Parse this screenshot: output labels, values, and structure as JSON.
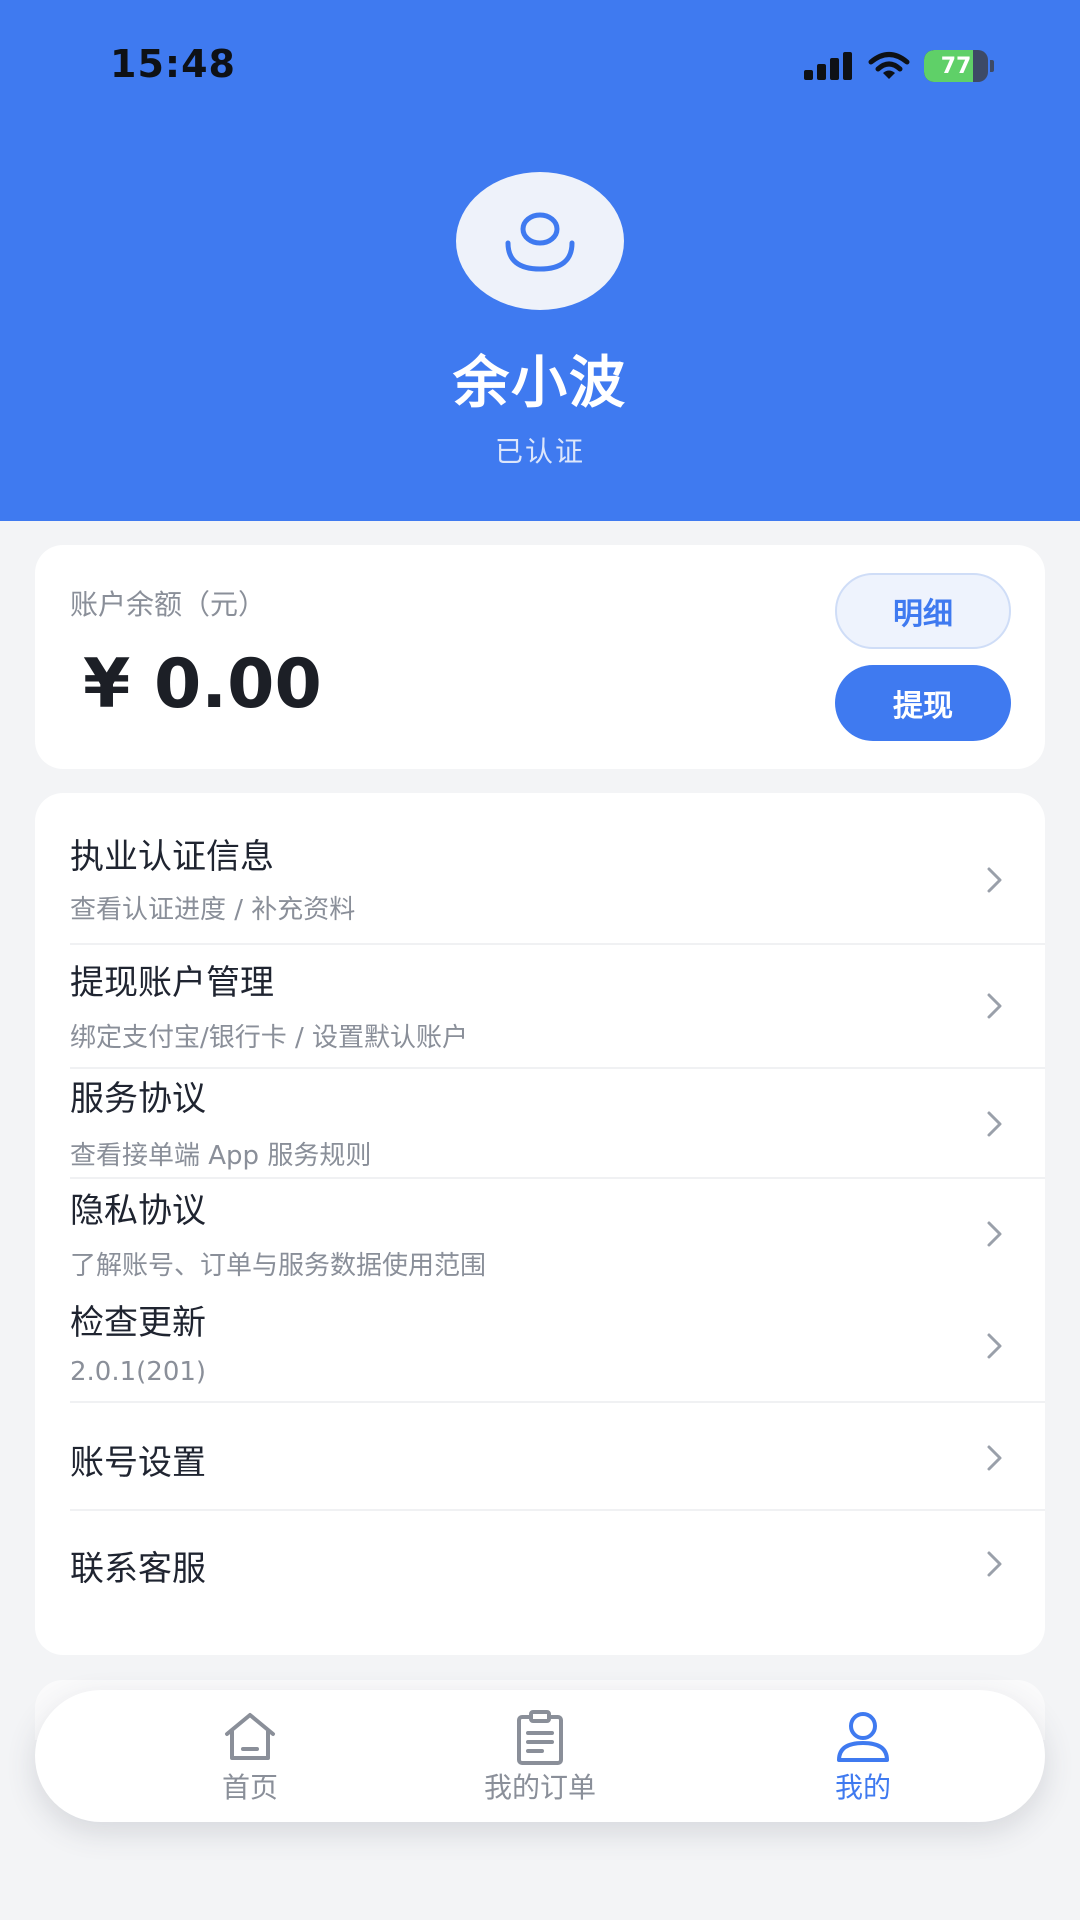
{
  "status_bar": {
    "time": "15:48",
    "battery": "77",
    "battery_level": 0.77
  },
  "profile": {
    "name": "余小波",
    "status": "已认证"
  },
  "balance": {
    "label": "账户余额（元）",
    "value": "¥ 0.00",
    "detail_label": "明细",
    "withdraw_label": "提现"
  },
  "menu": {
    "items": [
      {
        "title": "执业认证信息",
        "subtitle": "查看认证进度 / 补充资料"
      },
      {
        "title": "提现账户管理",
        "subtitle": "绑定支付宝/银行卡 / 设置默认账户"
      },
      {
        "title": "服务协议",
        "subtitle": "查看接单端 App 服务规则"
      },
      {
        "title": "隐私协议",
        "subtitle": "了解账号、订单与服务数据使用范围"
      },
      {
        "title": "检查更新",
        "subtitle": "2.0.1(201)"
      },
      {
        "title": "账号设置"
      },
      {
        "title": "联系客服"
      }
    ]
  },
  "tabbar": {
    "tabs": [
      {
        "label": "首页",
        "icon": "home-icon"
      },
      {
        "label": "我的订单",
        "icon": "clipboard-icon"
      },
      {
        "label": "我的",
        "icon": "person-icon",
        "active": true
      }
    ]
  },
  "colors": {
    "primary": "#3F7AF0",
    "background": "#F3F4F6",
    "text": "#1F2430",
    "muted": "#8A8F99",
    "battery": "#5FD068"
  }
}
